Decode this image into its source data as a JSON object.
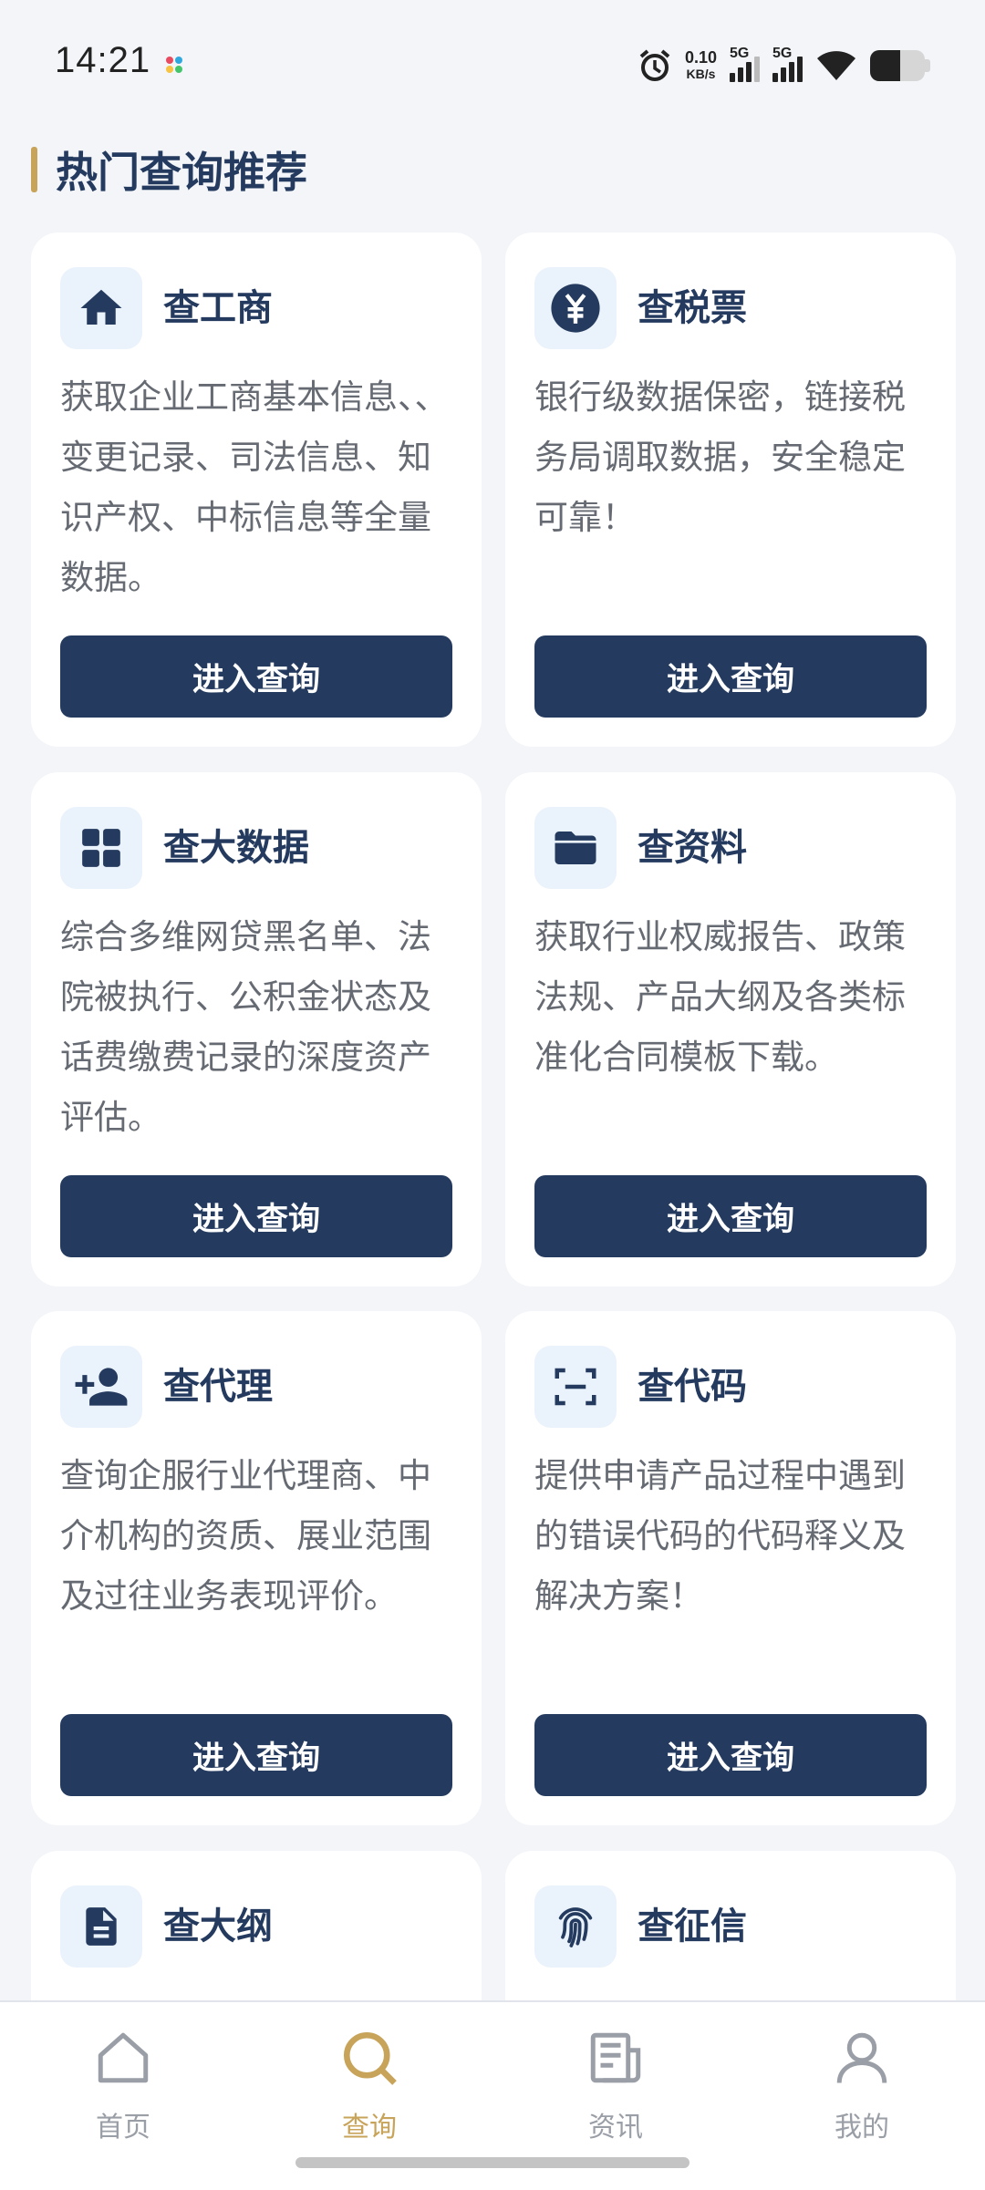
{
  "status_bar": {
    "time": "14:21",
    "net_speed_value": "0.10",
    "net_speed_unit": "KB/s",
    "sim1": "5G",
    "sim2": "5G"
  },
  "section_title": "热门查询推荐",
  "cards": [
    {
      "icon": "home-icon",
      "title": "查工商",
      "desc": "获取企业工商基本信息、、变更记录、司法信息、知识产权、中标信息等全量数据。",
      "button": "进入查询"
    },
    {
      "icon": "yen-icon",
      "title": "查税票",
      "desc": "银行级数据保密，链接税务局调取数据，安全稳定可靠！",
      "button": "进入查询"
    },
    {
      "icon": "grid-icon",
      "title": "查大数据",
      "desc": "综合多维网贷黑名单、法院被执行、公积金状态及话费缴费记录的深度资产评估。",
      "button": "进入查询"
    },
    {
      "icon": "folder-icon",
      "title": "查资料",
      "desc": "获取行业权威报告、政策法规、产品大纲及各类标准化合同模板下载。",
      "button": "进入查询"
    },
    {
      "icon": "person-add-icon",
      "title": "查代理",
      "desc": "查询企服行业代理商、中介机构的资质、展业范围及过往业务表现评价。",
      "button": "进入查询"
    },
    {
      "icon": "scan-icon",
      "title": "查代码",
      "desc": "提供申请产品过程中遇到的错误代码的代码释义及解决方案！",
      "button": "进入查询"
    },
    {
      "icon": "document-icon",
      "title": "查大纲"
    },
    {
      "icon": "fingerprint-icon",
      "title": "查征信"
    }
  ],
  "nav": {
    "items": [
      {
        "label": "首页",
        "icon": "home-outline-icon"
      },
      {
        "label": "查询",
        "icon": "search-icon",
        "active": true
      },
      {
        "label": "资讯",
        "icon": "news-icon"
      },
      {
        "label": "我的",
        "icon": "user-icon"
      }
    ]
  },
  "colors": {
    "primary": "#243a5e",
    "accent": "#c8a45a",
    "background": "#f3f5f9"
  }
}
